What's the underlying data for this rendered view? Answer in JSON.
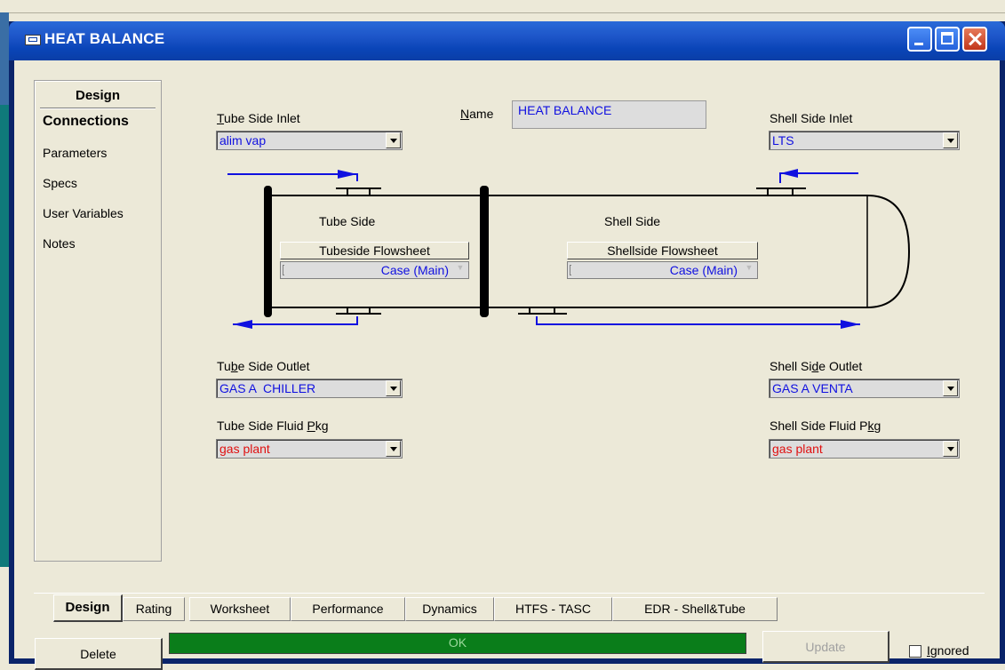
{
  "window": {
    "title": "HEAT BALANCE"
  },
  "nav": {
    "heading": "Design",
    "items": [
      {
        "label": "Connections",
        "active": true
      },
      {
        "label": "Parameters"
      },
      {
        "label": "Specs"
      },
      {
        "label": "User Variables"
      },
      {
        "label": "Notes"
      }
    ]
  },
  "name": {
    "label": "Name",
    "value": "HEAT BALANCE"
  },
  "tube_inlet": {
    "label": "Tube Side Inlet",
    "value": "alim vap"
  },
  "shell_inlet": {
    "label": "Shell Side Inlet",
    "value": "LTS"
  },
  "tube_outlet": {
    "label": "Tube Side Outlet",
    "value": "GAS A  CHILLER"
  },
  "shell_outlet": {
    "label": "Shell Side Outlet",
    "value": "GAS A VENTA"
  },
  "tube_pkg": {
    "label": "Tube Side Fluid Pkg",
    "value": "gas plant"
  },
  "shell_pkg": {
    "label": "Shell Side Fluid Pkg",
    "value": "gas plant"
  },
  "diagram": {
    "tube_label": "Tube Side",
    "shell_label": "Shell Side",
    "tube_flowsheet_button": "Tubeside Flowsheet",
    "shell_flowsheet_button": "Shellside Flowsheet",
    "tube_flowsheet_value": "Case (Main)",
    "shell_flowsheet_value": "Case (Main)"
  },
  "tabs": [
    "Design",
    "Rating",
    "Worksheet",
    "Performance",
    "Dynamics",
    "HTFS - TASC",
    "EDR - Shell&Tube"
  ],
  "active_tab": "Design",
  "bottom": {
    "delete": "Delete",
    "status": "OK",
    "update": "Update",
    "ignored": "Ignored",
    "ignored_checked": false
  },
  "colors": {
    "status_ok": "#0a7d1a",
    "stream_line": "#1010e0",
    "value_blue": "#1010e0",
    "value_red": "#e01010"
  }
}
